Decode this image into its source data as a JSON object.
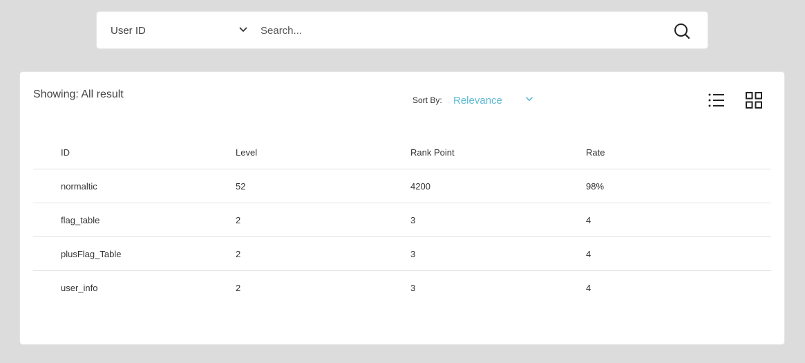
{
  "search": {
    "filter_label": "User ID",
    "placeholder": "Search...",
    "value": ""
  },
  "results": {
    "showing_label": "Showing: All result",
    "sort_label": "Sort By:",
    "sort_value": "Relevance"
  },
  "icons": {
    "filter_chevron": "chevron-down-icon",
    "search": "search-icon",
    "sort_chevron": "chevron-down-icon",
    "list_view": "list-view-icon",
    "grid_view": "grid-view-icon"
  },
  "colors": {
    "accent": "#5bb8d4",
    "background": "#dcdcdc",
    "card": "#ffffff"
  },
  "table": {
    "columns": [
      "ID",
      "Level",
      "Rank Point",
      "Rate"
    ],
    "rows": [
      [
        "normaltic",
        "52",
        "4200",
        "98%"
      ],
      [
        "flag_table",
        "2",
        "3",
        "4"
      ],
      [
        "plusFlag_Table",
        "2",
        "3",
        "4"
      ],
      [
        "user_info",
        "2",
        "3",
        "4"
      ]
    ]
  }
}
